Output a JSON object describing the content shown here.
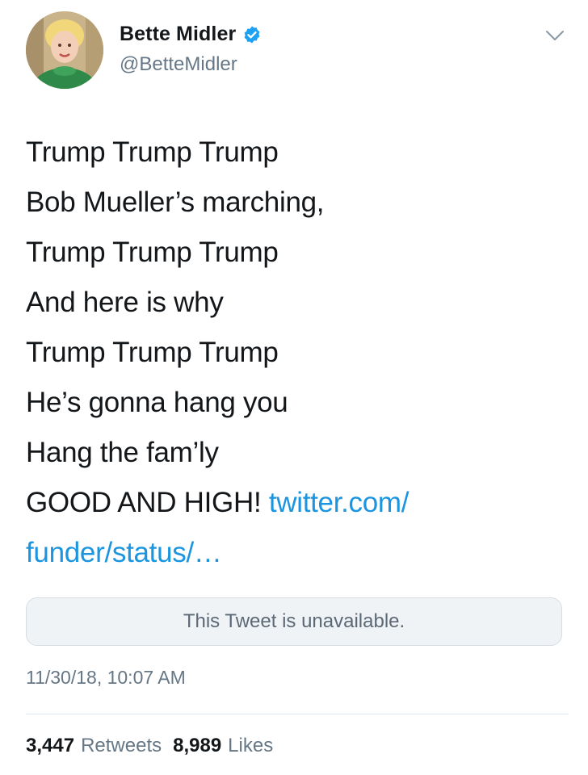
{
  "tweet": {
    "author": {
      "display_name": "Bette Midler",
      "handle": "@BetteMidler",
      "verified": true,
      "avatar_icon": "profile-photo"
    },
    "menu_icon": "chevron-down-icon",
    "text_lines": [
      "Trump Trump Trump",
      "Bob Mueller’s marching,",
      "Trump Trump Trump",
      "And here is why",
      "Trump Trump Trump",
      "He’s gonna hang you",
      "Hang the fam’ly",
      "GOOD AND HIGH! "
    ],
    "link_part1": "twitter.com/",
    "link_part2": "funder/status/…",
    "quoted_tweet_notice": "This Tweet is unavailable.",
    "timestamp": "11/30/18, 10:07 AM",
    "stats": {
      "retweets_count": "3,447",
      "retweets_label": "Retweets",
      "likes_count": "8,989",
      "likes_label": "Likes"
    },
    "colors": {
      "link": "#1b95e0",
      "verified_badge": "#1da1f2",
      "secondary_text": "#657786"
    }
  }
}
